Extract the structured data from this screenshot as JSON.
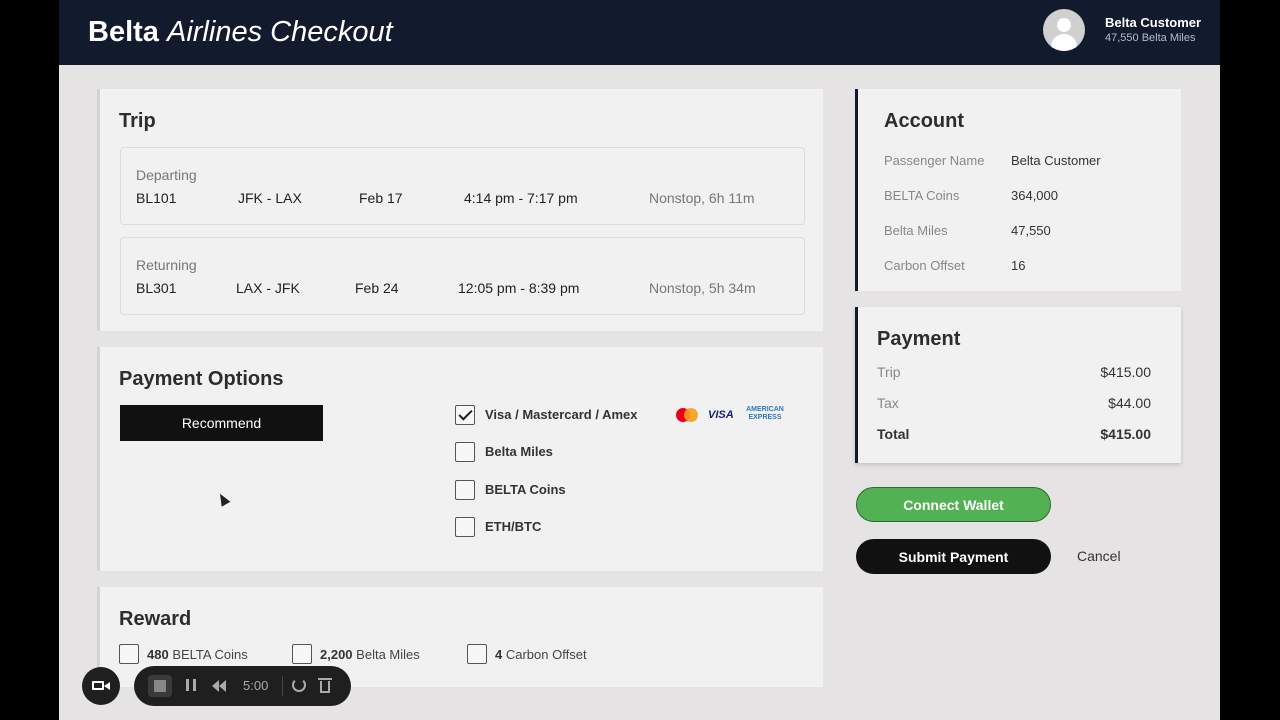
{
  "header": {
    "brand_bold": "Belta",
    "brand_italic": "Airlines Checkout",
    "user_name": "Belta Customer",
    "user_miles": "47,550 Belta Miles"
  },
  "trip": {
    "title": "Trip",
    "departing": {
      "label": "Departing",
      "flight": "BL101",
      "route": "JFK - LAX",
      "date": "Feb 17",
      "time": "4:14 pm - 7:17 pm",
      "duration": "Nonstop, 6h 11m"
    },
    "returning": {
      "label": "Returning",
      "flight": "BL301",
      "route": "LAX - JFK",
      "date": "Feb 24",
      "time": "12:05 pm - 8:39 pm",
      "duration": "Nonstop, 5h 34m"
    }
  },
  "payment_options": {
    "title": "Payment Options",
    "recommend_label": "Recommend",
    "options": [
      {
        "label": "Visa / Mastercard / Amex",
        "checked": true
      },
      {
        "label": "Belta Miles",
        "checked": false
      },
      {
        "label": "BELTA Coins",
        "checked": false
      },
      {
        "label": "ETH/BTC",
        "checked": false
      }
    ],
    "logos": {
      "visa": "VISA",
      "amex_line1": "AMERICAN",
      "amex_line2": "EXPRESS"
    }
  },
  "reward": {
    "title": "Reward",
    "items": [
      {
        "amount": "480",
        "unit": "BELTA Coins"
      },
      {
        "amount": "2,200",
        "unit": "Belta Miles"
      },
      {
        "amount": "4",
        "unit": "Carbon Offset"
      }
    ]
  },
  "account": {
    "title": "Account",
    "rows": [
      {
        "key": "Passenger Name",
        "value": "Belta Customer"
      },
      {
        "key": "BELTA Coins",
        "value": "364,000"
      },
      {
        "key": "Belta Miles",
        "value": "47,550"
      },
      {
        "key": "Carbon Offset",
        "value": "16"
      }
    ]
  },
  "payment": {
    "title": "Payment",
    "rows": [
      {
        "key": "Trip",
        "value": "$415.00"
      },
      {
        "key": "Tax",
        "value": "$44.00"
      },
      {
        "key": "Total",
        "value": "$415.00"
      }
    ]
  },
  "actions": {
    "connect_wallet": "Connect Wallet",
    "submit_payment": "Submit Payment",
    "cancel": "Cancel"
  },
  "recorder": {
    "timer": "5:00"
  },
  "colors": {
    "header_bg": "#121a2e",
    "connect_green": "#52b152",
    "submit_black": "#111111"
  }
}
